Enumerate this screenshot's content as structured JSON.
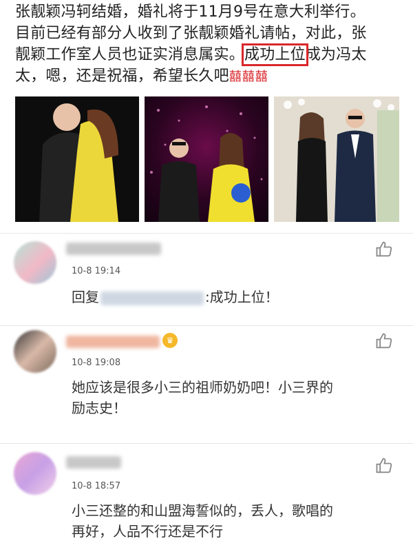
{
  "post": {
    "line1": "张靓颖冯轲结婚，婚礼将于11月9号在意大利举行。",
    "line2": "目前已经有部分人收到了张靓颖婚礼请帖，对此，张",
    "line3_before": "靓颖工作室人员也证实消息属实。",
    "highlight": "成功上位",
    "line3_after": "成为冯太",
    "line4": "太，嗯，还是祝福，希望长久吧",
    "emoji": "囍囍囍",
    "photos": [
      "couple-hug-photo",
      "stage-performance-photo",
      "couple-event-photo"
    ]
  },
  "comments": [
    {
      "time": "10-8 19:14",
      "reply_prefix": "回复",
      "text": ":成功上位！",
      "avatar_colors": [
        "#b7e3d6",
        "#f2b8c6",
        "#9bc7d8"
      ]
    },
    {
      "time": "10-8 19:08",
      "line1": "她应该是很多小三的祖师奶奶吧！小三界的",
      "line2": "励志史！",
      "avatar_colors": [
        "#3a3a3a",
        "#d9b9a8",
        "#7d6b5e"
      ]
    },
    {
      "time": "10-8 18:57",
      "line1": "小三还整的和山盟海誓似的，丢人，歌唱的",
      "line2": "再好，人品不行还是不行",
      "avatar_colors": [
        "#e8a6d4",
        "#c7a0e6",
        "#f1d0ea"
      ]
    }
  ],
  "colors": {
    "highlight_border": "#d9262b",
    "text": "#222222",
    "timestamp": "#555555"
  }
}
